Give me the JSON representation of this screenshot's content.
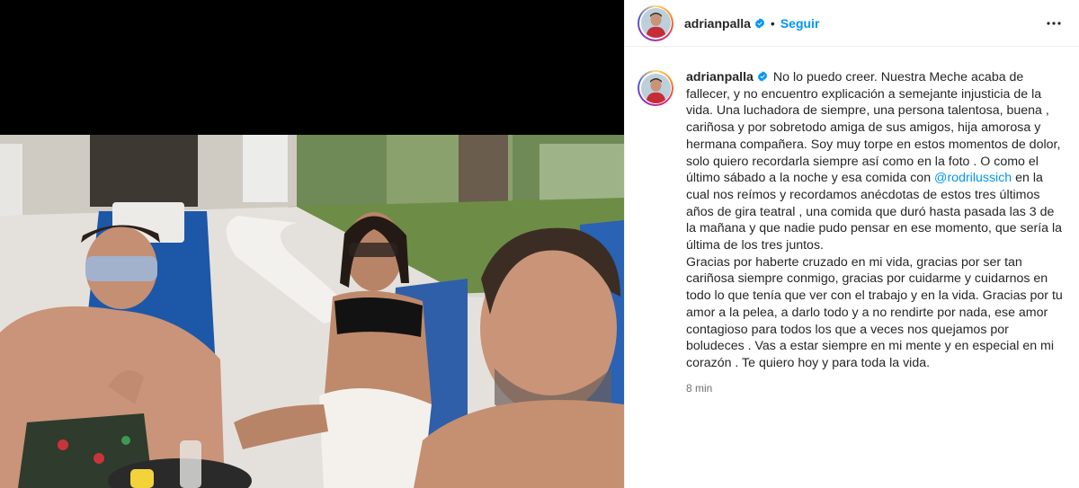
{
  "post": {
    "username": "adrianpalla",
    "verified": true,
    "dot": "•",
    "follow_label": "Seguir",
    "more_icon": "more-horizontal-icon",
    "caption_part1": "No lo puedo creer. Nuestra Meche acaba de fallecer, y no encuentro explicación a semejante injusticia de la vida. Una luchadora de siempre, una persona talentosa, buena , cariñosa y por sobretodo amiga de sus amigos, hija amorosa y hermana compañera. Soy muy torpe en estos momentos de dolor, solo quiero recordarla siempre así como en la foto . O como el último sábado a la noche y esa comida con ",
    "mention": "@rodrilussich",
    "caption_part2": " en la cual nos reímos y recordamos anécdotas de estos tres últimos años de gira teatral , una comida que duró hasta pasada las 3 de la mañana y que nadie pudo pensar en ese momento, que sería la última de los tres juntos.",
    "caption_part3": "Gracias por haberte cruzado en mi vida, gracias por ser tan cariñosa siempre conmigo, gracias por cuidarme y cuidarnos en todo lo que tenía que ver con el trabajo y en la vida. Gracias por tu amor a la pelea, a darlo todo y a no rendirte por nada, ese amor contagioso para todos los que a veces nos quejamos por boludeces . Vas a estar siempre en mi mente y en especial en mi corazón . Te quiero hoy y para toda la vida.",
    "time_ago": "8 min"
  },
  "colors": {
    "accent": "#0095f6",
    "verified": "#0095f6",
    "text": "#262626",
    "muted": "#737373"
  }
}
